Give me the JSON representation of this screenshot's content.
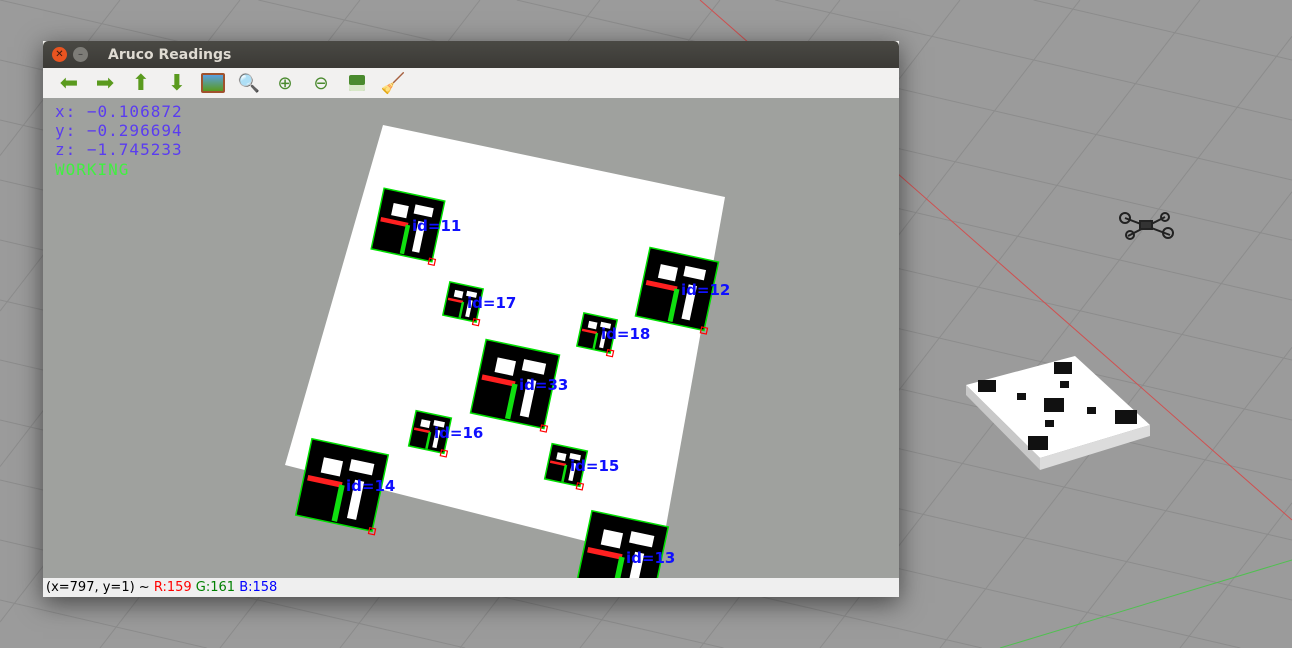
{
  "window": {
    "title": "Aruco Readings"
  },
  "toolbar": {
    "items": [
      {
        "name": "pan-left",
        "icon": "arrow-left-icon"
      },
      {
        "name": "pan-right",
        "icon": "arrow-right-icon"
      },
      {
        "name": "pan-up",
        "icon": "arrow-up-icon"
      },
      {
        "name": "pan-down",
        "icon": "arrow-down-icon"
      },
      {
        "name": "zoom-fit",
        "icon": "image-icon"
      },
      {
        "name": "zoom-region",
        "icon": "zoom-image-icon"
      },
      {
        "name": "zoom-in",
        "icon": "zoom-in-icon"
      },
      {
        "name": "zoom-out",
        "icon": "zoom-out-icon"
      },
      {
        "name": "save",
        "icon": "save-icon"
      },
      {
        "name": "properties",
        "icon": "brush-icon"
      }
    ]
  },
  "readouts": {
    "x": "x: −0.106872",
    "y": "y: −0.296694",
    "z": "z: −1.745233",
    "state": "WORKING"
  },
  "markers": [
    {
      "label": "id=11"
    },
    {
      "label": "id=12"
    },
    {
      "label": "id=17"
    },
    {
      "label": "id=18"
    },
    {
      "label": "id=33"
    },
    {
      "label": "id=16"
    },
    {
      "label": "id=15"
    },
    {
      "label": "id=14"
    },
    {
      "label": "id=13"
    }
  ],
  "status": {
    "coords": "(x=797, y=1) ~ ",
    "r": "R:159",
    "g": "G:161",
    "b": "B:158"
  },
  "colors": {
    "readout": "#5a3cf0",
    "working": "#40f040",
    "label": "#1010ff",
    "r": "#ff0000",
    "g": "#008000",
    "b": "#0000ff"
  }
}
